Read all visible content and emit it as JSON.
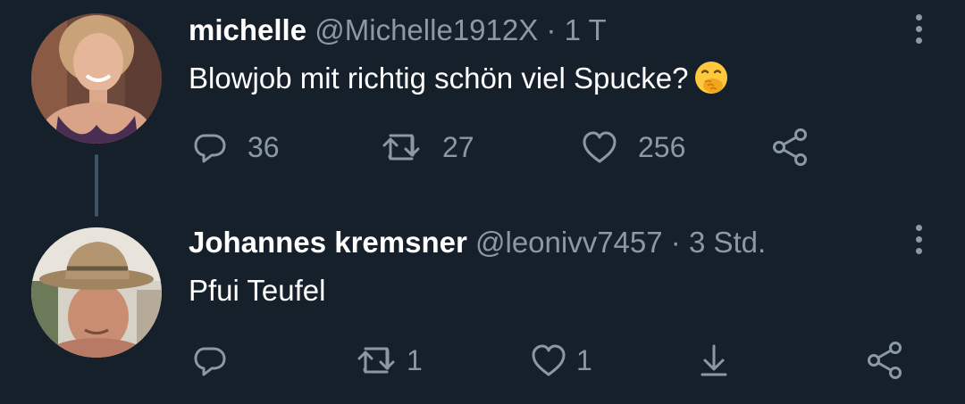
{
  "tweets": [
    {
      "display_name": "michelle",
      "handle": "@Michelle1912X",
      "separator": "·",
      "time": "1 T",
      "text": "Blowjob mit richtig schön viel Spucke?",
      "emoji": "face-with-hand-over-mouth",
      "replies": "36",
      "retweets": "27",
      "likes": "256"
    },
    {
      "display_name": "Johannes kremsner",
      "handle": "@leonivv7457",
      "separator": "·",
      "time": "3 Std.",
      "text": "Pfui Teufel",
      "replies": "",
      "retweets": "1",
      "likes": "1"
    }
  ],
  "colors": {
    "background": "#16202b",
    "secondary_text": "#8b98a5",
    "thread_line": "#3d5466"
  }
}
